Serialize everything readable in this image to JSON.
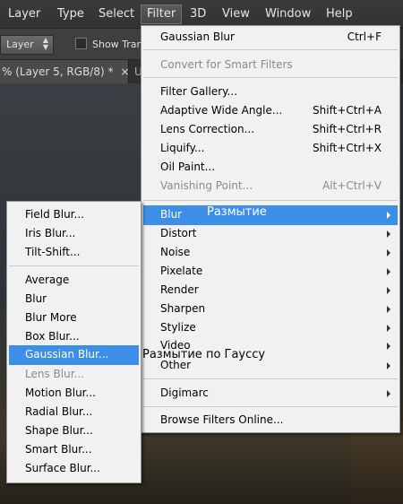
{
  "menubar": {
    "items": [
      "Layer",
      "Type",
      "Select",
      "Filter",
      "3D",
      "View",
      "Window",
      "Help"
    ]
  },
  "options": {
    "layer_select": "Layer",
    "show_transform": "Show Tran"
  },
  "tab": {
    "title": "% (Layer 5, RGB/8) *",
    "close": "×",
    "other": "U"
  },
  "filter_menu": {
    "last_filter": {
      "label": "Gaussian Blur",
      "shortcut": "Ctrl+F"
    },
    "convert": "Convert for Smart Filters",
    "gallery": "Filter Gallery...",
    "adaptive": {
      "label": "Adaptive Wide Angle...",
      "shortcut": "Shift+Ctrl+A"
    },
    "lens": {
      "label": "Lens Correction...",
      "shortcut": "Shift+Ctrl+R"
    },
    "liquify": {
      "label": "Liquify...",
      "shortcut": "Shift+Ctrl+X"
    },
    "oil": "Oil Paint...",
    "vanishing": {
      "label": "Vanishing Point...",
      "shortcut": "Alt+Ctrl+V"
    },
    "blur": "Blur",
    "distort": "Distort",
    "noise": "Noise",
    "pixelate": "Pixelate",
    "render": "Render",
    "sharpen": "Sharpen",
    "stylize": "Stylize",
    "video": "Video",
    "other": "Other",
    "digimarc": "Digimarc",
    "browse": "Browse Filters Online..."
  },
  "blur_menu": {
    "items": [
      "Field Blur...",
      "Iris Blur...",
      "Tilt-Shift...",
      "Average",
      "Blur",
      "Blur More",
      "Box Blur...",
      "Gaussian Blur...",
      "Lens Blur...",
      "Motion Blur...",
      "Radial Blur...",
      "Shape Blur...",
      "Smart Blur...",
      "Surface Blur..."
    ]
  },
  "annotations": {
    "blur_ru": "Размытие",
    "gaussian_ru": "Размытие по Гауссу"
  },
  "colors": {
    "highlight": "#3d8ee7",
    "menu_bg": "#f1f1f1",
    "menubar_bg": "#3b3b3b",
    "annotation_blur": "#ffffff",
    "annotation_gaussian": "#000000"
  }
}
